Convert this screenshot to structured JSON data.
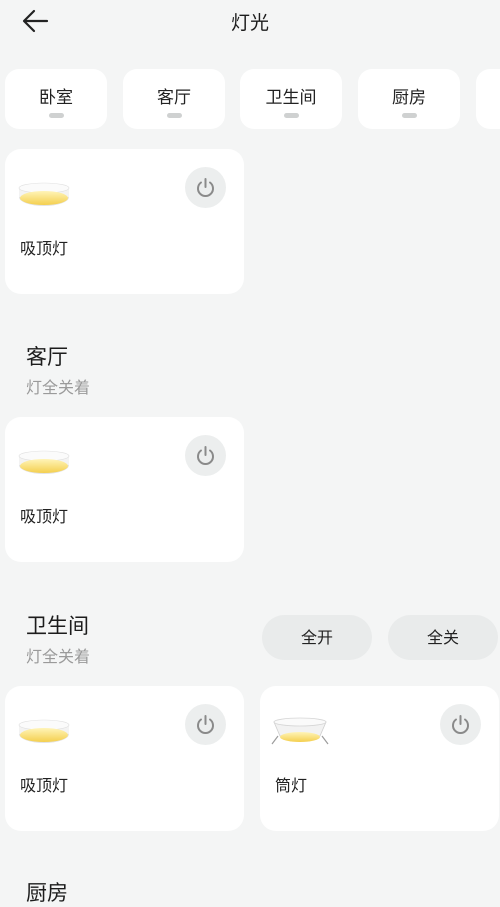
{
  "header": {
    "title": "灯光"
  },
  "tabs": [
    {
      "label": "卧室"
    },
    {
      "label": "客厅"
    },
    {
      "label": "卫生间"
    },
    {
      "label": "厨房"
    },
    {
      "label": ""
    }
  ],
  "bedroom": {
    "devices": [
      {
        "name": "吸顶灯"
      }
    ]
  },
  "living_room": {
    "title": "客厅",
    "status": "灯全关着",
    "devices": [
      {
        "name": "吸顶灯"
      }
    ]
  },
  "bathroom": {
    "title": "卫生间",
    "status": "灯全关着",
    "all_on_label": "全开",
    "all_off_label": "全关",
    "devices": [
      {
        "name": "吸顶灯"
      },
      {
        "name": "筒灯"
      }
    ]
  },
  "kitchen": {
    "title": "厨房"
  },
  "colors": {
    "background": "#f4f5f5",
    "card": "#ffffff",
    "lamp_glow": "#f7dc6f",
    "subtext": "#9a9a9a"
  },
  "icons": [
    "back-arrow-icon",
    "ceiling-lamp-icon",
    "downlight-icon",
    "power-icon"
  ]
}
